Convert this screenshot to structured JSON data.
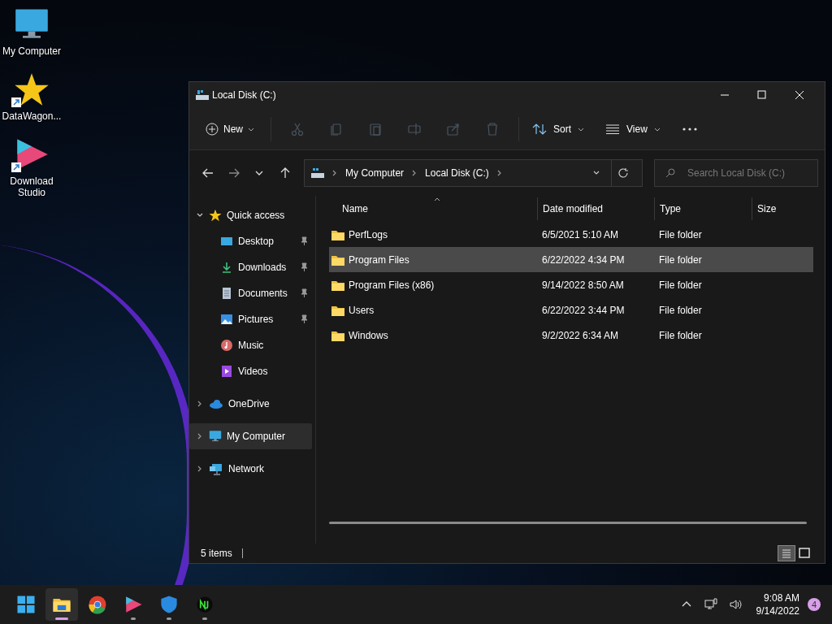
{
  "desktop_icons": [
    {
      "kind": "monitor",
      "label": "My Computer",
      "shortcut": false
    },
    {
      "kind": "star",
      "label": "DataWagon...",
      "shortcut": true
    },
    {
      "kind": "ds",
      "label": "Download Studio",
      "shortcut": true
    }
  ],
  "window": {
    "title": "Local Disk (C:)"
  },
  "toolbar": {
    "new": "New",
    "actions": [
      {
        "kind": "cut",
        "disabled": true
      },
      {
        "kind": "copy",
        "disabled": true
      },
      {
        "kind": "paste",
        "disabled": true
      },
      {
        "kind": "rename",
        "disabled": true
      },
      {
        "kind": "share",
        "disabled": true
      },
      {
        "kind": "delete",
        "disabled": true
      }
    ],
    "sort": "Sort",
    "view": "View"
  },
  "address": {
    "crumbs": [
      "My Computer",
      "Local Disk (C:)"
    ],
    "search_placeholder": "Search Local Disk (C:)"
  },
  "nav": [
    {
      "kind": "star",
      "label": "Quick access",
      "expanded": true,
      "selected": false,
      "children": [
        {
          "kind": "desktop",
          "label": "Desktop",
          "pinned": true
        },
        {
          "kind": "download",
          "label": "Downloads",
          "pinned": true
        },
        {
          "kind": "document",
          "label": "Documents",
          "pinned": true
        },
        {
          "kind": "picture",
          "label": "Pictures",
          "pinned": true
        },
        {
          "kind": "music",
          "label": "Music",
          "pinned": false
        },
        {
          "kind": "video",
          "label": "Videos",
          "pinned": false
        }
      ]
    },
    {
      "kind": "cloud",
      "label": "OneDrive",
      "expanded": false,
      "selected": false
    },
    {
      "kind": "monitor",
      "label": "My Computer",
      "expanded": false,
      "selected": true
    },
    {
      "kind": "network",
      "label": "Network",
      "expanded": false,
      "selected": false
    }
  ],
  "columns": [
    "Name",
    "Date modified",
    "Type",
    "Size"
  ],
  "rows": [
    {
      "name": "PerfLogs",
      "date": "6/5/2021 5:10 AM",
      "type": "File folder",
      "selected": false
    },
    {
      "name": "Program Files",
      "date": "6/22/2022 4:34 PM",
      "type": "File folder",
      "selected": true
    },
    {
      "name": "Program Files (x86)",
      "date": "9/14/2022 8:50 AM",
      "type": "File folder",
      "selected": false
    },
    {
      "name": "Users",
      "date": "6/22/2022 3:44 PM",
      "type": "File folder",
      "selected": false
    },
    {
      "name": "Windows",
      "date": "9/2/2022 6:34 AM",
      "type": "File folder",
      "selected": false
    }
  ],
  "status_bar": {
    "count": "5 items",
    "views": [
      {
        "kind": "details",
        "selected": true
      },
      {
        "kind": "tiles",
        "selected": false
      }
    ]
  },
  "taskbar": {
    "apps": [
      {
        "kind": "start",
        "running": false,
        "active": false
      },
      {
        "kind": "explorer",
        "running": true,
        "active": true
      },
      {
        "kind": "chrome",
        "running": false,
        "active": false
      },
      {
        "kind": "ds",
        "running": true,
        "active": false
      },
      {
        "kind": "shield",
        "running": true,
        "active": false
      },
      {
        "kind": "nj",
        "running": true,
        "active": false
      }
    ],
    "time": "9:08 AM",
    "date": "9/14/2022",
    "notifications": "4"
  }
}
